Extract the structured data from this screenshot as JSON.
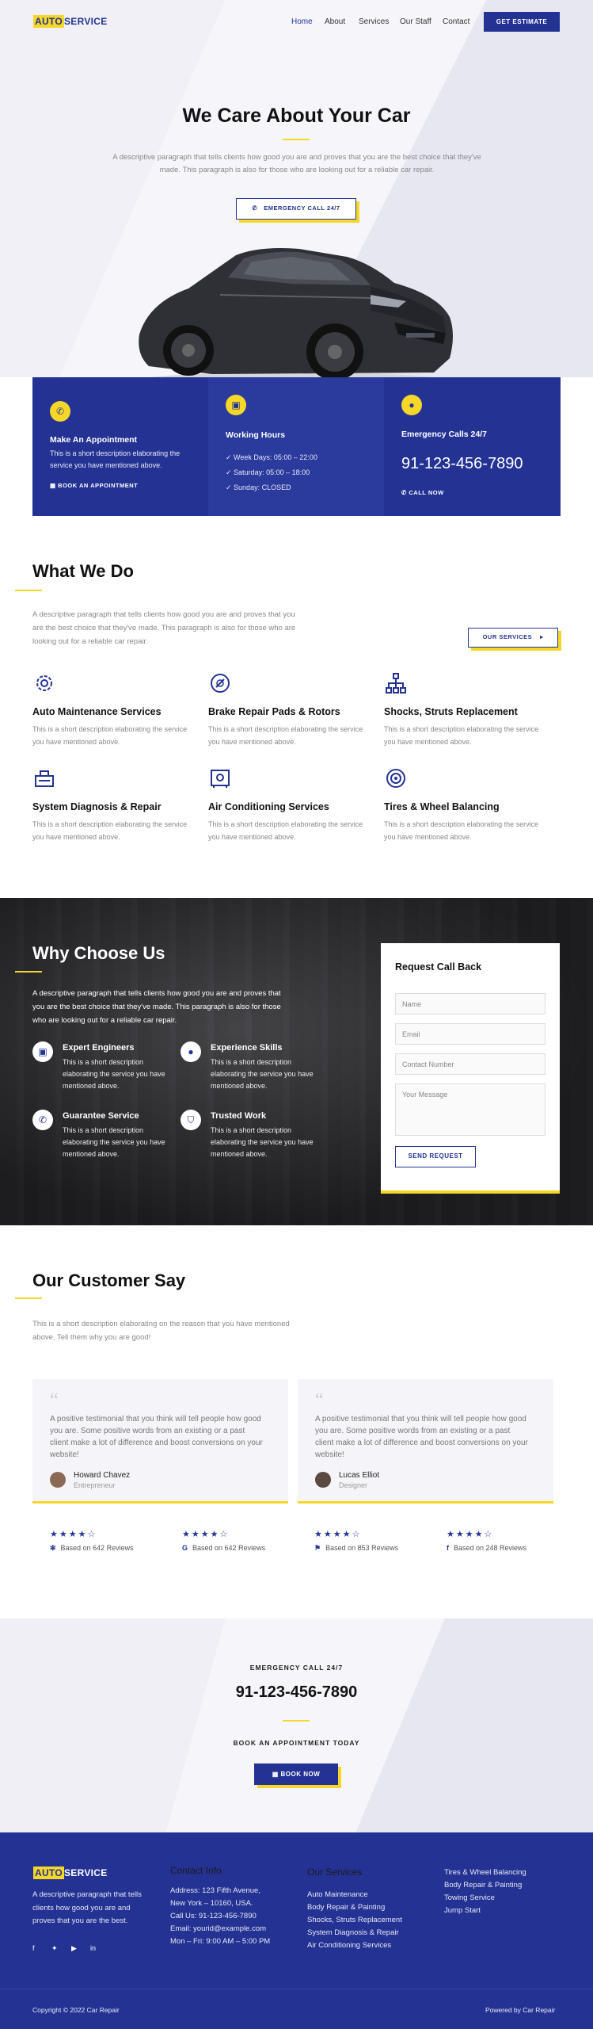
{
  "header": {
    "logo_a": "AUTO",
    "logo_b": "SERVICE",
    "nav": [
      "Home",
      "About",
      "Services",
      "Our Staff",
      "Contact"
    ],
    "cta": "GET ESTIMATE"
  },
  "hero": {
    "title": "We Care About Your Car",
    "paragraph": "A descriptive paragraph that tells clients how good you are and proves that you are the best choice that they've made. This paragraph is also for those who are looking out for a reliable car repair.",
    "button": "EMERGENCY CALL 24/7"
  },
  "info": {
    "appointment": {
      "title": "Make An Appointment",
      "text": "This is a short description elaborating the service you have mentioned above.",
      "link": "BOOK AN APPOINTMENT"
    },
    "hours": {
      "title": "Working Hours",
      "items": [
        "Week Days: 05:00 – 22:00",
        "Saturday: 05:00 – 18:00",
        "Sunday: CLOSED"
      ]
    },
    "emergency": {
      "title": "Emergency Calls 24/7",
      "phone": "91-123-456-7890",
      "link": "CALL NOW"
    }
  },
  "what_we_do": {
    "title": "What We Do",
    "paragraph": "A descriptive paragraph that tells clients how good you are and proves that you are the best choice that they've made. This paragraph is also for those who are looking out for a reliable car repair.",
    "button": "OUR SERVICES",
    "services": [
      {
        "title": "Auto Maintenance Services",
        "text": "This is a short description elaborating the service you have mentioned above.",
        "icon": "gear-icon"
      },
      {
        "title": "Brake Repair Pads & Rotors",
        "text": "This is a short description elaborating the service you have mentioned above.",
        "icon": "brake-icon"
      },
      {
        "title": "Shocks, Struts Replacement",
        "text": "This is a short description elaborating the service you have mentioned above.",
        "icon": "hierarchy-icon"
      },
      {
        "title": "System Diagnosis & Repair",
        "text": "This is a short description elaborating the service you have mentioned above.",
        "icon": "diagnostic-icon"
      },
      {
        "title": "Air Conditioning Services",
        "text": "This is a short description elaborating the service you have mentioned above.",
        "icon": "safe-icon"
      },
      {
        "title": "Tires & Wheel Balancing",
        "text": "This is a short description elaborating the service you have mentioned above.",
        "icon": "tire-icon"
      }
    ]
  },
  "why": {
    "title": "Why Choose Us",
    "paragraph": "A descriptive paragraph that tells clients how good you are and proves that you are the best choice that they've made. This paragraph is also for those who are looking out for a reliable car repair.",
    "items": [
      {
        "title": "Expert Engineers",
        "text": "This is a short description elaborating the service you have mentioned above."
      },
      {
        "title": "Experience Skills",
        "text": "This is a short description elaborating the service you have mentioned above."
      },
      {
        "title": "Guarantee Service",
        "text": "This is a short description elaborating the service you have mentioned above."
      },
      {
        "title": "Trusted Work",
        "text": "This is a short description elaborating the service you have mentioned above."
      }
    ]
  },
  "form": {
    "title": "Request Call Back",
    "name": "Name",
    "email": "Email",
    "contact": "Contact Number",
    "message": "Your Message",
    "button": "SEND REQUEST"
  },
  "testimonials": {
    "title": "Our Customer Say",
    "paragraph": "This is a short description elaborating on the reason that you have mentioned above. Tell them why you are good!",
    "cards": [
      {
        "quote": "A positive testimonial that you think will tell people how good you are. Some positive words from an existing or a past client make a lot of difference and boost conversions on your website!",
        "name": "Howard Chavez",
        "role": "Entrepreneur"
      },
      {
        "quote": "A positive testimonial that you think will tell people how good you are. Some positive words from an existing or a past client make a lot of difference and boost conversions on your website!",
        "name": "Lucas Elliot",
        "role": "Designer"
      }
    ],
    "ratings": [
      {
        "stars": "★★★★☆",
        "source": "yelp",
        "text": "Based on 642 Reviews"
      },
      {
        "stars": "★★★★☆",
        "source": "G",
        "text": "Based on 642 Reviews"
      },
      {
        "stars": "★★★★☆",
        "source": "foursquare",
        "text": "Based on 853 Reviews"
      },
      {
        "stars": "★★★★☆",
        "source": "f",
        "text": "Based on 248 Reviews"
      }
    ]
  },
  "call": {
    "label": "EMERGENCY CALL 24/7",
    "phone": "91-123-456-7890",
    "sub": "BOOK AN APPOINTMENT TODAY",
    "button": "BOOK NOW"
  },
  "footer": {
    "about": "A descriptive paragraph that tells clients how good you are and proves that you are the best.",
    "contact_title": "Contact Info",
    "contact": [
      "Address: 123 Fifth Avenue,",
      "New York – 10160, USA.",
      "Call Us: 91-123-456-7890",
      "Email: yourid@example.com",
      "Mon – Fri: 9:00 AM – 5:00 PM"
    ],
    "services_title": "Our Services",
    "services_a": [
      "Auto Maintenance",
      "Body Repair & Painting",
      "Shocks, Struts Replacement",
      "System Diagnosis & Repair",
      "Air Conditioning Services"
    ],
    "services_b": [
      "Tires & Wheel Balancing",
      "Body Repair & Painting",
      "Towing Service",
      "Jump Start"
    ],
    "copyright": "Copyright © 2022 Car Repair",
    "powered": "Powered by Car Repair"
  },
  "colors": {
    "primary": "#243393",
    "accent": "#f5d72a"
  }
}
